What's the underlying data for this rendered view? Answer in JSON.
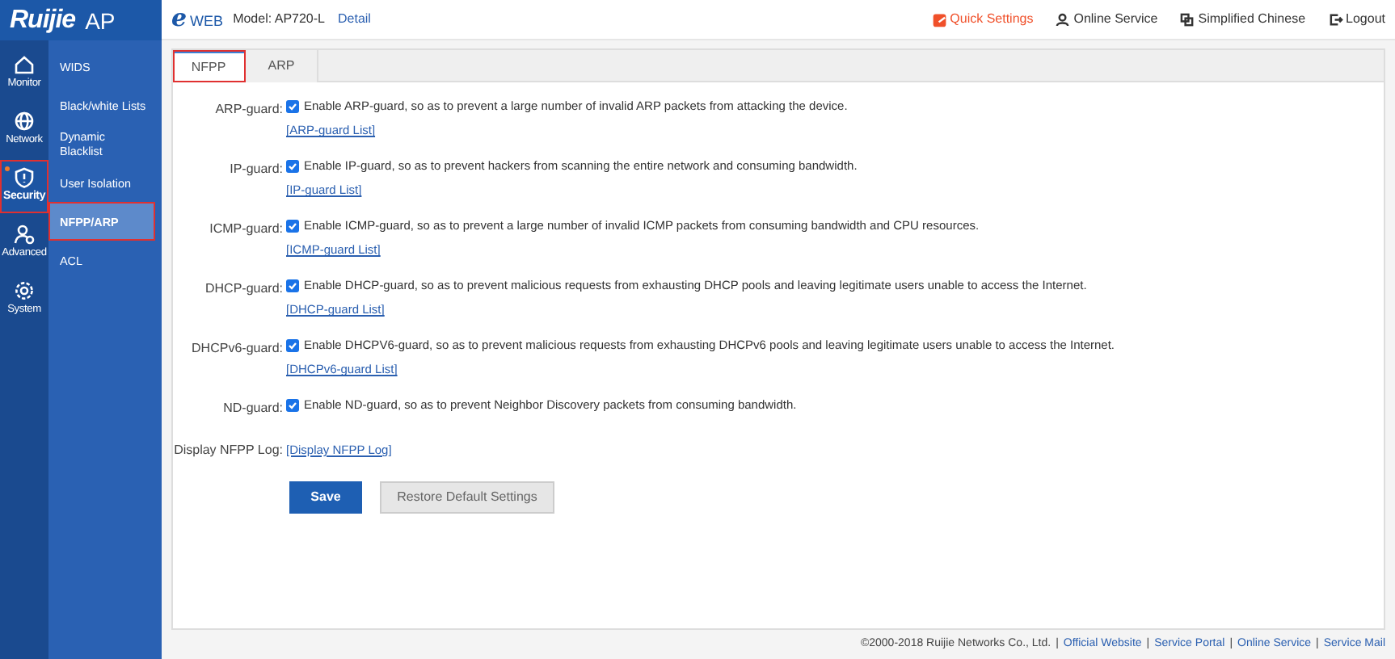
{
  "logo": {
    "brand": "Ruijie",
    "product": "AP"
  },
  "header": {
    "brand_mark": "e",
    "brand_name": "WEB",
    "model": "Model: AP720-L",
    "detail_link": "Detail",
    "actions": [
      {
        "kind": "quick",
        "label": "Quick Settings"
      },
      {
        "kind": "service",
        "label": "Online Service"
      },
      {
        "kind": "language",
        "label": "Simplified Chinese"
      },
      {
        "kind": "logout",
        "label": "Logout"
      }
    ]
  },
  "main_nav": [
    {
      "kind": "monitor",
      "label": "Monitor",
      "selected": false
    },
    {
      "kind": "network",
      "label": "Network",
      "selected": false
    },
    {
      "kind": "security",
      "label": "Security",
      "selected": true
    },
    {
      "kind": "advanced",
      "label": "Advanced",
      "selected": false
    },
    {
      "kind": "system",
      "label": "System",
      "selected": false
    }
  ],
  "sub_nav": [
    {
      "label": "WIDS",
      "selected": false
    },
    {
      "label": "Black/white Lists",
      "selected": false
    },
    {
      "label": "Dynamic Blacklist",
      "selected": false
    },
    {
      "label": "User Isolation",
      "selected": false
    },
    {
      "label": "NFPP/ARP",
      "selected": true
    },
    {
      "label": "ACL",
      "selected": false
    }
  ],
  "tabs": [
    {
      "label": "NFPP",
      "selected": true
    },
    {
      "label": "ARP",
      "selected": false
    }
  ],
  "guards": [
    {
      "label": "ARP-guard:",
      "checked": true,
      "text": "Enable ARP-guard, so as to prevent a large number of invalid ARP packets from attacking the device.",
      "link": "[ARP-guard List]"
    },
    {
      "label": "IP-guard:",
      "checked": true,
      "text": "Enable IP-guard, so as to prevent hackers from scanning the entire network and consuming bandwidth.",
      "link": "[IP-guard List]"
    },
    {
      "label": "ICMP-guard:",
      "checked": true,
      "text": "Enable ICMP-guard, so as to prevent a large number of invalid ICMP packets from consuming bandwidth and CPU resources.",
      "link": "[ICMP-guard List]"
    },
    {
      "label": "DHCP-guard:",
      "checked": true,
      "text": "Enable DHCP-guard, so as to prevent malicious requests from exhausting DHCP pools and leaving legitimate users unable to access the Internet.",
      "link": "[DHCP-guard List]"
    },
    {
      "label": "DHCPv6-guard:",
      "checked": true,
      "text": "Enable DHCPV6-guard, so as to prevent malicious requests from exhausting DHCPv6 pools and leaving legitimate users unable to access the Internet.",
      "link": "[DHCPv6-guard List]"
    },
    {
      "label": "ND-guard:",
      "checked": true,
      "text": "Enable ND-guard, so as to prevent Neighbor Discovery packets from consuming bandwidth."
    }
  ],
  "log": {
    "label": "Display NFPP Log:",
    "link": "[Display NFPP Log]"
  },
  "buttons": [
    {
      "kind": "primary",
      "label": "Save"
    },
    {
      "kind": "secondary",
      "label": "Restore Default Settings"
    }
  ],
  "footer": {
    "copyright": "©2000-2018 Ruijie Networks Co., Ltd.",
    "links": [
      {
        "separator": "|",
        "label": "Official Website"
      },
      {
        "separator": "|",
        "label": "Service Portal"
      },
      {
        "separator": "|",
        "label": "Online Service"
      },
      {
        "separator": "|",
        "label": "Service Mail"
      }
    ]
  }
}
